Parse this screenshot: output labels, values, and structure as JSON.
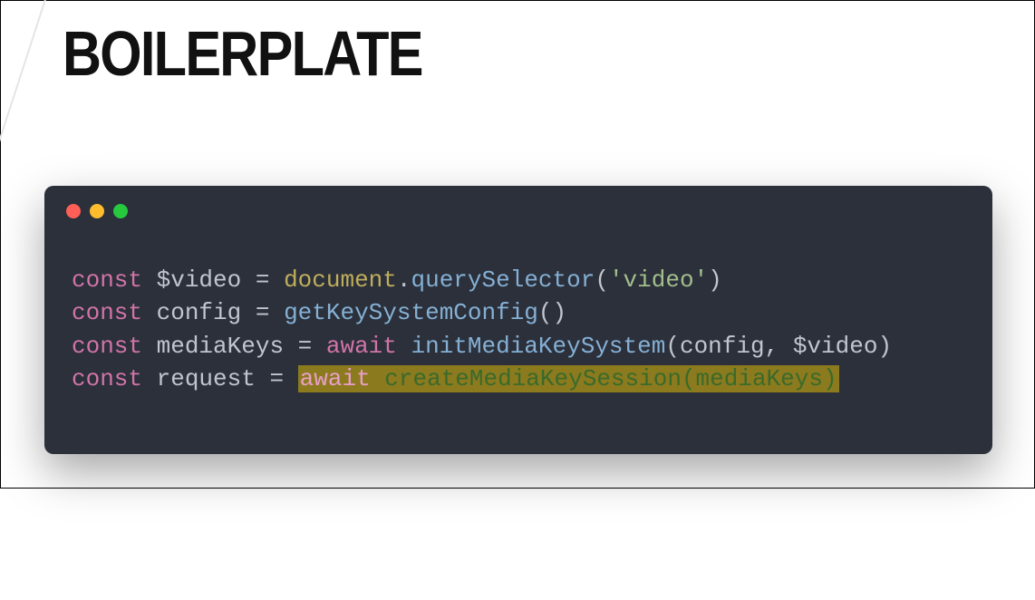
{
  "slide": {
    "title": "BOILERPLATE"
  },
  "window": {
    "controls": [
      "close",
      "minimize",
      "zoom"
    ]
  },
  "code": {
    "lines": [
      {
        "tokens": [
          {
            "t": "const ",
            "c": "kw"
          },
          {
            "t": "$video",
            "c": "var"
          },
          {
            "t": " = ",
            "c": "op"
          },
          {
            "t": "document",
            "c": "obj"
          },
          {
            "t": ".",
            "c": "pun"
          },
          {
            "t": "querySelector",
            "c": "fn"
          },
          {
            "t": "(",
            "c": "pun"
          },
          {
            "t": "'video'",
            "c": "str"
          },
          {
            "t": ")",
            "c": "pun"
          }
        ]
      },
      {
        "tokens": [
          {
            "t": "const ",
            "c": "kw"
          },
          {
            "t": "config",
            "c": "var"
          },
          {
            "t": " = ",
            "c": "op"
          },
          {
            "t": "getKeySystemConfig",
            "c": "call"
          },
          {
            "t": "()",
            "c": "pun"
          }
        ]
      },
      {
        "tokens": [
          {
            "t": "const ",
            "c": "kw"
          },
          {
            "t": "mediaKeys",
            "c": "var"
          },
          {
            "t": " = ",
            "c": "op"
          },
          {
            "t": "await ",
            "c": "kw"
          },
          {
            "t": "initMediaKeySystem",
            "c": "call"
          },
          {
            "t": "(",
            "c": "pun"
          },
          {
            "t": "config",
            "c": "var"
          },
          {
            "t": ", ",
            "c": "pun"
          },
          {
            "t": "$video",
            "c": "var"
          },
          {
            "t": ")",
            "c": "pun"
          }
        ]
      },
      {
        "tokens": [
          {
            "t": "const ",
            "c": "kw"
          },
          {
            "t": "request",
            "c": "var"
          },
          {
            "t": " = ",
            "c": "op"
          },
          {
            "hl": true,
            "tokens": [
              {
                "t": "await ",
                "c": "kw"
              },
              {
                "t": "createMediaKeySession",
                "c": "call"
              },
              {
                "t": "(",
                "c": "pun"
              },
              {
                "t": "mediaKeys",
                "c": "var"
              },
              {
                "t": ")",
                "c": "pun"
              }
            ]
          }
        ]
      }
    ]
  }
}
